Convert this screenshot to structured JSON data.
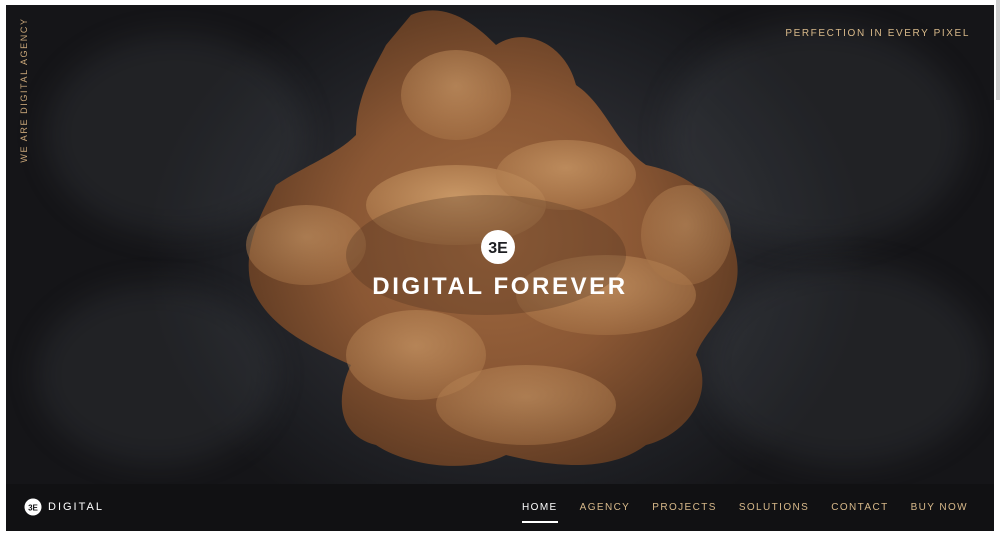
{
  "hero": {
    "side_tagline": "WE ARE DIGITAL AGENCY",
    "top_tagline": "PERFECTION IN EVERY PIXEL",
    "title": "DIGITAL FOREVER",
    "logo_glyph": "3E"
  },
  "brand": {
    "logo_glyph": "3E",
    "name": "DIGITAL"
  },
  "nav": {
    "items": [
      {
        "label": "HOME",
        "active": true
      },
      {
        "label": "AGENCY",
        "active": false
      },
      {
        "label": "PROJECTS",
        "active": false
      },
      {
        "label": "SOLUTIONS",
        "active": false
      },
      {
        "label": "CONTACT",
        "active": false
      },
      {
        "label": "BUY NOW",
        "active": false
      }
    ]
  },
  "colors": {
    "accent": "#d8b98a",
    "background": "#1d1e22",
    "navbar": "#111113",
    "ink_cloud": "#8a5a38"
  }
}
